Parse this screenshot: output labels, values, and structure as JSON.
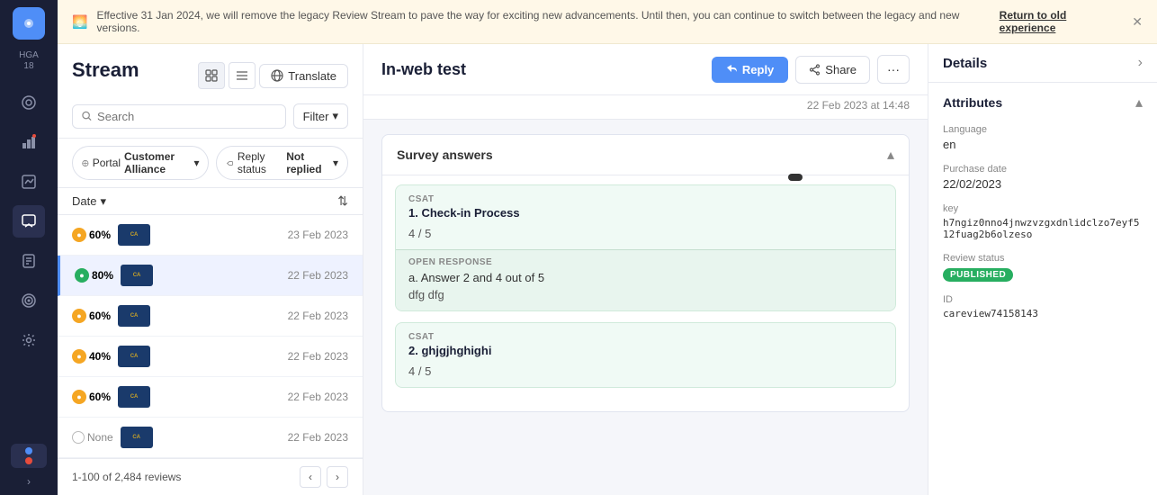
{
  "sidebar": {
    "logo_text": "●",
    "org_name": "HGA",
    "org_number": "18",
    "icons": [
      "◎",
      "📊",
      "📈",
      "🗂",
      "☰",
      "🎯",
      "⚙"
    ]
  },
  "banner": {
    "text": "Effective 31 Jan 2024, we will remove the legacy Review Stream to pave the way for exciting new advancements. Until then, you can continue to switch between the legacy and new versions.",
    "cta_text": "Return to old experience",
    "icon": "🌅"
  },
  "stream": {
    "title": "Stream",
    "search_placeholder": "Search",
    "filter_label": "Filter",
    "portal_label": "Portal",
    "portal_value": "Customer Alliance",
    "reply_status_label": "Reply status",
    "reply_status_value": "Not replied",
    "sort_label": "Date",
    "pagination_text": "1-100 of 2,484 reviews",
    "reviews": [
      {
        "score": "60%",
        "score_type": "yellow",
        "date": "23 Feb 2023"
      },
      {
        "score": "80%",
        "score_type": "green",
        "date": "22 Feb 2023",
        "active": true
      },
      {
        "score": "60%",
        "score_type": "yellow",
        "date": "22 Feb 2023"
      },
      {
        "score": "40%",
        "score_type": "yellow",
        "date": "22 Feb 2023"
      },
      {
        "score": "60%",
        "score_type": "yellow",
        "date": "22 Feb 2023"
      },
      {
        "score": "None",
        "score_type": "none",
        "date": "22 Feb 2023"
      }
    ]
  },
  "detail": {
    "title": "In-web test",
    "reply_btn": "Reply",
    "share_btn": "Share",
    "more_btn": "···",
    "date": "22 Feb 2023 at 14:48",
    "survey_section_title": "Survey answers",
    "csat_items": [
      {
        "type_label": "CSAT",
        "question": "1. Check-in Process",
        "score": "4 / 5",
        "has_open_response": true,
        "open_response_label": "OPEN RESPONSE",
        "open_response_text": "a. Answer 2 and 4 out of 5",
        "open_response_answer": "dfg dfg"
      },
      {
        "type_label": "CSAT",
        "question": "2. ghjgjhghighi",
        "score": "4 / 5",
        "has_open_response": false
      }
    ]
  },
  "details_panel": {
    "title": "Details",
    "attributes_title": "Attributes",
    "language_label": "Language",
    "language_value": "en",
    "purchase_date_label": "Purchase date",
    "purchase_date_value": "22/02/2023",
    "key_label": "key",
    "key_value": "h7ngiz0nno4jnwzvzgxdnlidclzo7eyf512fuag2b6olzeso",
    "review_status_label": "Review status",
    "review_status_value": "PUBLISHED",
    "id_label": "ID",
    "id_value": "careview74158143"
  },
  "icons": {
    "search": "🔍",
    "filter_arrow": "▾",
    "portal_icon": "🔄",
    "reply_icon": "↩",
    "sort_icon": "⇅",
    "grid_view": "⊞",
    "list_view": "≡",
    "translate_icon": "🌐",
    "chevron_down": "▾",
    "chevron_up": "▴",
    "chevron_right": "›",
    "caret_right": ">",
    "play": "▶",
    "record": "⏺"
  }
}
